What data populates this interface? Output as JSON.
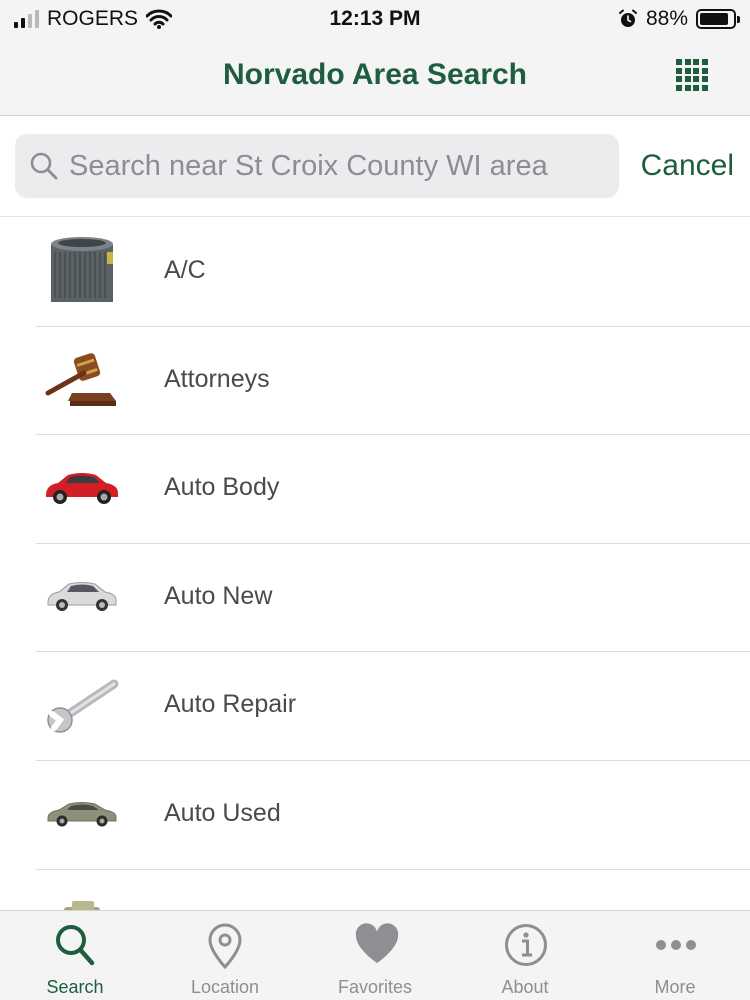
{
  "status_bar": {
    "carrier": "ROGERS",
    "time": "12:13 PM",
    "battery": "88%",
    "battery_level": 0.88
  },
  "nav": {
    "title": "Norvado Area Search",
    "grid_icon": "grid-icon"
  },
  "search": {
    "placeholder": "Search near St Croix County WI area",
    "value": "",
    "cancel_label": "Cancel"
  },
  "list": {
    "items": [
      {
        "label": "A/C",
        "icon": "ac-unit-icon"
      },
      {
        "label": "Attorneys",
        "icon": "gavel-icon"
      },
      {
        "label": "Auto Body",
        "icon": "red-car-icon"
      },
      {
        "label": "Auto New",
        "icon": "silver-car-icon"
      },
      {
        "label": "Auto Repair",
        "icon": "wrench-icon"
      },
      {
        "label": "Auto Used",
        "icon": "sedan-icon"
      },
      {
        "label": "",
        "icon": "money-icon"
      }
    ]
  },
  "tab_bar": {
    "tabs": [
      {
        "label": "Search",
        "icon": "search-icon",
        "active": true
      },
      {
        "label": "Location",
        "icon": "location-pin-icon",
        "active": false
      },
      {
        "label": "Favorites",
        "icon": "heart-icon",
        "active": false
      },
      {
        "label": "About",
        "icon": "info-icon",
        "active": false
      },
      {
        "label": "More",
        "icon": "more-icon",
        "active": false
      }
    ]
  },
  "colors": {
    "accent": "#1e5e3f",
    "inactive": "#8e8e93",
    "bar_background": "#f4f4f5"
  }
}
